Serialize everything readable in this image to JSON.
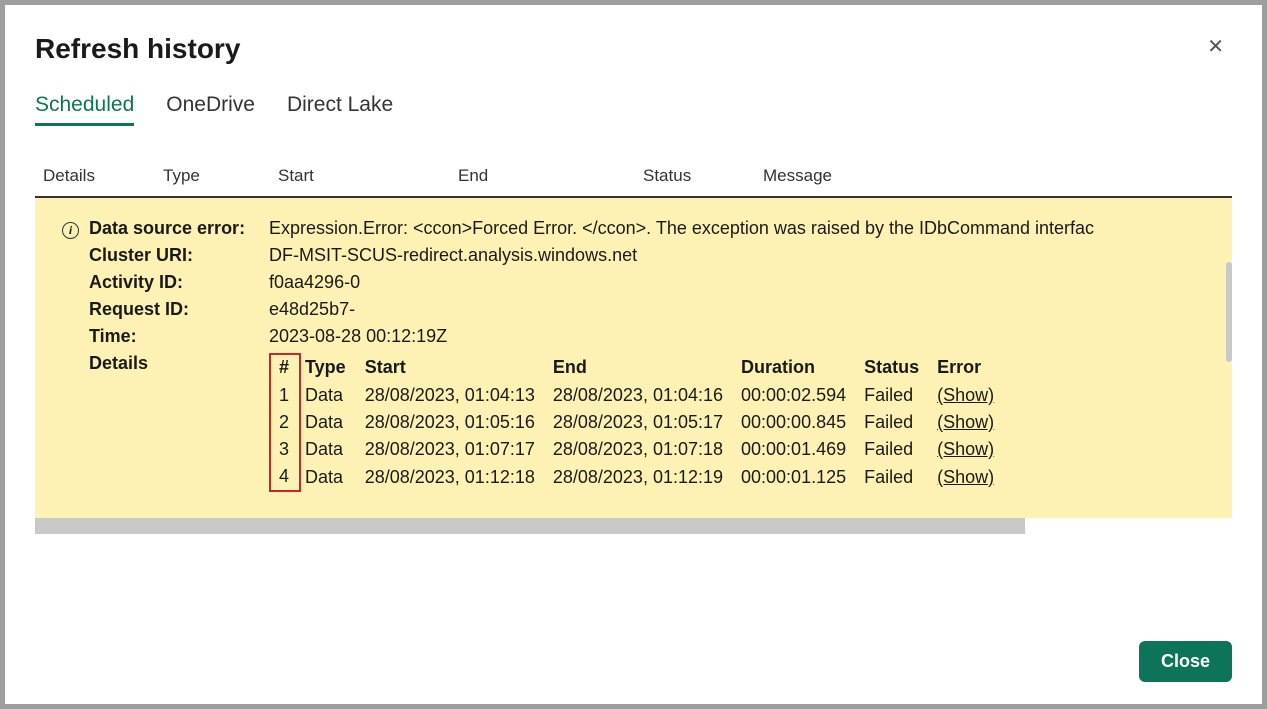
{
  "dialog": {
    "title": "Refresh history",
    "close_button_label": "Close"
  },
  "tabs": [
    {
      "label": "Scheduled",
      "active": true
    },
    {
      "label": "OneDrive",
      "active": false
    },
    {
      "label": "Direct Lake",
      "active": false
    }
  ],
  "table_headers": {
    "details": "Details",
    "type": "Type",
    "start": "Start",
    "end": "End",
    "status": "Status",
    "message": "Message"
  },
  "error_panel": {
    "labels": {
      "data_source_error": "Data source error:",
      "cluster_uri": "Cluster URI:",
      "activity_id": "Activity ID:",
      "request_id": "Request ID:",
      "time": "Time:",
      "details": "Details"
    },
    "values": {
      "data_source_error": "Expression.Error: <ccon>Forced Error. </ccon>. The exception was raised by the IDbCommand interfac",
      "cluster_uri": "DF-MSIT-SCUS-redirect.analysis.windows.net",
      "activity_id": "f0aa4296-0",
      "request_id": "e48d25b7-",
      "time": "2023-08-28 00:12:19Z"
    }
  },
  "details_table": {
    "headers": {
      "num": "#",
      "type": "Type",
      "start": "Start",
      "end": "End",
      "duration": "Duration",
      "status": "Status",
      "error": "Error"
    },
    "show_label": "(Show)",
    "rows": [
      {
        "num": "1",
        "type": "Data",
        "start": "28/08/2023, 01:04:13",
        "end": "28/08/2023, 01:04:16",
        "duration": "00:00:02.594",
        "status": "Failed"
      },
      {
        "num": "2",
        "type": "Data",
        "start": "28/08/2023, 01:05:16",
        "end": "28/08/2023, 01:05:17",
        "duration": "00:00:00.845",
        "status": "Failed"
      },
      {
        "num": "3",
        "type": "Data",
        "start": "28/08/2023, 01:07:17",
        "end": "28/08/2023, 01:07:18",
        "duration": "00:00:01.469",
        "status": "Failed"
      },
      {
        "num": "4",
        "type": "Data",
        "start": "28/08/2023, 01:12:18",
        "end": "28/08/2023, 01:12:19",
        "duration": "00:00:01.125",
        "status": "Failed"
      }
    ]
  }
}
